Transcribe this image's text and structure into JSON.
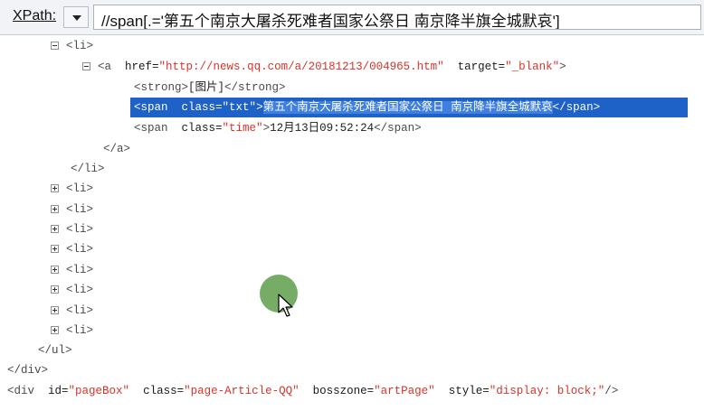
{
  "xpath_bar": {
    "label": "XPath:",
    "query": "//span[.='第五个南京大屠杀死难者国家公祭日 南京降半旗全城默哀']"
  },
  "tree": {
    "li_open": "<li>",
    "a_open": "<a",
    "href_attr": "href=",
    "href_val": "\"http://news.qq.com/a/20181213/004965.htm\"",
    "target_attr": "target=",
    "target_val": "\"_blank\"",
    "a_open_end": ">",
    "strong_open": "<strong>",
    "strong_text": "[图片]",
    "strong_close": "</strong>",
    "span_open": "<span",
    "class_attr": "class=",
    "txt_class_val": "\"txt\"",
    "span_gt": ">",
    "span_text": "第五个南京大屠杀死难者国家公祭日  南京降半旗全城默哀",
    "span_close": "</span>",
    "time_class_val": "\"time\"",
    "time_text": "12月13日09:52:24",
    "a_close": "</a>",
    "li_close": "</li>",
    "collapsed_li": [
      "<li>",
      "<li>",
      "<li>",
      "<li>",
      "<li>",
      "<li>",
      "<li>",
      "<li>"
    ],
    "ul_close": "</ul>",
    "div_close": "</div>",
    "div_open": "<div",
    "id_attr": "id=",
    "id_val": "\"pageBox\"",
    "div_class_attr": "class=",
    "div_class_val": "\"page-Article-QQ\"",
    "bosszone_attr": "bosszone=",
    "bosszone_val": "\"artPage\"",
    "style_attr": "style=",
    "style_val": "\"display: block;\"",
    "div_open_end": "/>"
  },
  "colors": {
    "highlight": "#1e62c8",
    "attribute_value": "#d8332b",
    "cursor_dot": "#6fa85e"
  },
  "icons": [
    "collapse-icon",
    "expand-icon",
    "dropdown-arrow-icon",
    "mouse-cursor-icon"
  ]
}
